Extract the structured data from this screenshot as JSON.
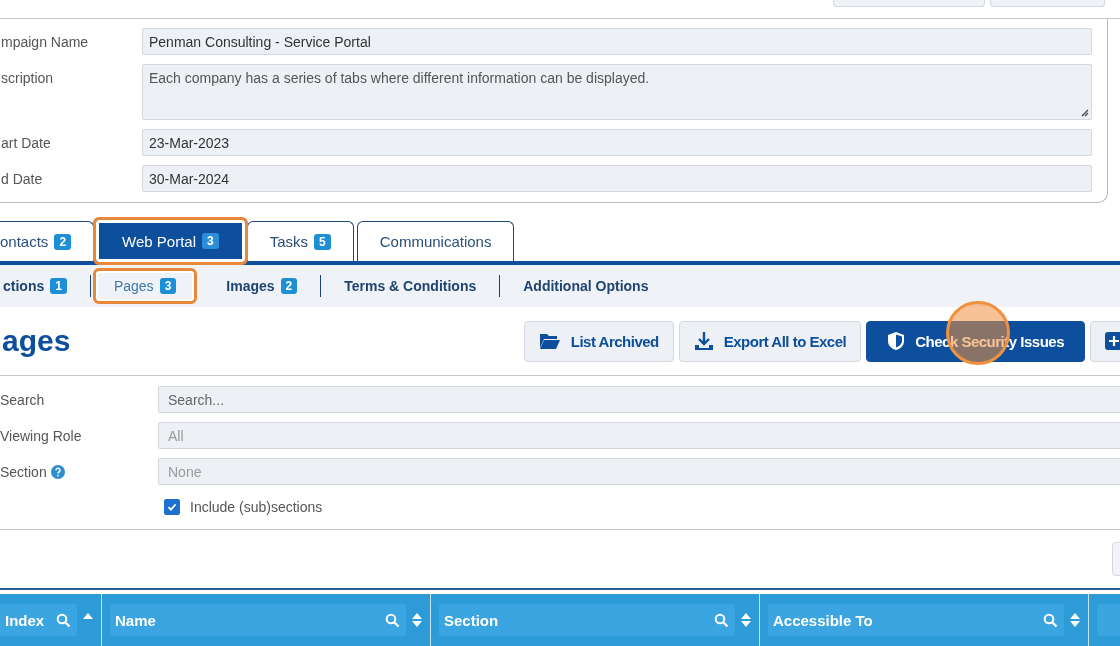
{
  "campaign_form": [
    {
      "label": "mpaign Name",
      "value": "Penman Consulting - Service Portal",
      "kind": "input"
    },
    {
      "label": "scription",
      "value": "Each company has a series of tabs where different information can be displayed.",
      "kind": "textarea"
    },
    {
      "label": "art Date",
      "value": "23-Mar-2023",
      "kind": "input"
    },
    {
      "label": "d Date",
      "value": "30-Mar-2024",
      "kind": "input"
    }
  ],
  "tabs": [
    {
      "label": "ontacts",
      "count": "2",
      "selected": false,
      "highlighted": false
    },
    {
      "label": "Web Portal",
      "count": "3",
      "selected": true,
      "highlighted": true
    },
    {
      "label": "Tasks",
      "count": "5",
      "selected": false,
      "highlighted": false
    },
    {
      "label": "Communications",
      "selected": false,
      "highlighted": false
    }
  ],
  "subtabs": [
    {
      "label": "ctions",
      "count": "1",
      "selected": false,
      "highlighted": false,
      "divider_after": true
    },
    {
      "label": "Pages",
      "count": "3",
      "selected": true,
      "highlighted": true,
      "divider_after": false
    },
    {
      "label": "Images",
      "count": "2",
      "selected": false,
      "highlighted": false,
      "divider_after": true
    },
    {
      "label": "Terms & Conditions",
      "selected": false,
      "highlighted": false,
      "divider_after": true
    },
    {
      "label": "Additional Options",
      "selected": false,
      "highlighted": false,
      "divider_after": false
    }
  ],
  "page_heading": "ages",
  "actions": [
    {
      "kind": "archive",
      "label": "List Archived",
      "primary": false,
      "click_marker": false
    },
    {
      "kind": "export",
      "label": "Export All to Excel",
      "primary": false,
      "click_marker": false
    },
    {
      "kind": "security",
      "label": "Check Security Issues",
      "primary": true,
      "click_marker": true
    },
    {
      "kind": "add",
      "primary": false,
      "click_marker": false
    }
  ],
  "filters": [
    {
      "label": "Search",
      "placeholder": "Search...",
      "help": false
    },
    {
      "label": "Viewing Role",
      "placeholder": "All",
      "help": false
    },
    {
      "label": "Section",
      "placeholder": "None",
      "help": true
    }
  ],
  "include_subsections": {
    "label": "Include (sub)sections",
    "checked": true
  },
  "table": {
    "columns": [
      {
        "label": "Index",
        "sorted": true
      },
      {
        "label": "Name",
        "sorted": false
      },
      {
        "label": "Section",
        "sorted": false
      },
      {
        "label": "Accessible To",
        "sorted": false
      }
    ]
  }
}
